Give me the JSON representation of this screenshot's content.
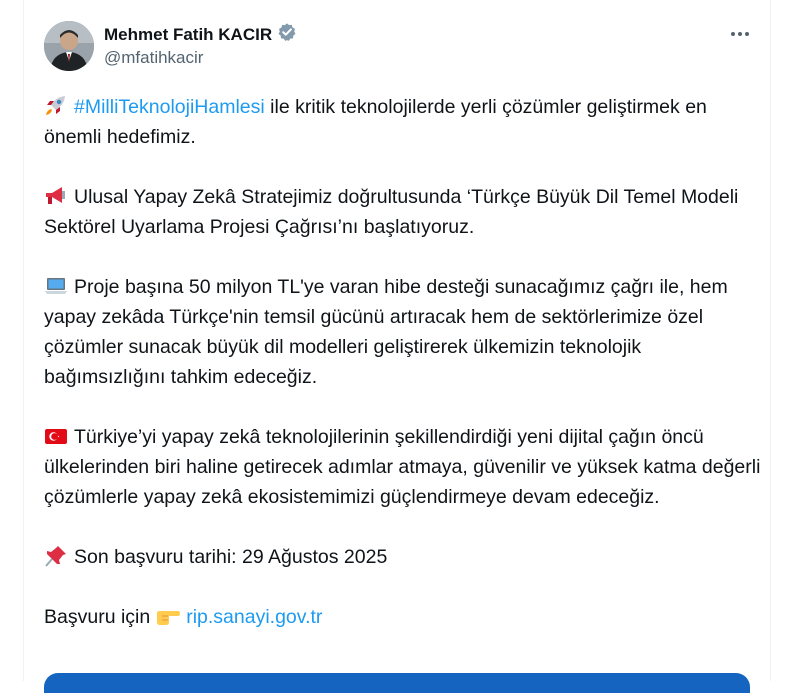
{
  "author": {
    "name": "Mehmet Fatih KACIR",
    "handle": "@mfatihkacir",
    "verified": true
  },
  "icons": {
    "more": "more-horizontal-icon",
    "verified": "verified-badge-icon"
  },
  "tweet": {
    "p1_hashtag": "#MilliTeknolojiHamlesi",
    "p1_text": " ile kritik teknolojilerde yerli çözümler geliştirmek en önemli hedefimiz.",
    "p2_text": "Ulusal Yapay Zekâ Stratejimiz doğrultusunda ‘Türkçe Büyük Dil Temel Modeli Sektörel Uyarlama Projesi Çağrısı’nı başlatıyoruz.",
    "p3_text": "Proje başına 50 milyon TL'ye varan hibe desteği sunacağımız çağrı ile, hem yapay zekâda Türkçe'nin temsil gücünü artıracak hem de sektörlerimize özel çözümler sunacak büyük dil modelleri geliştirerek ülkemizin teknolojik bağımsızlığını tahkim edeceğiz.",
    "p4_text": "Türkiye’yi yapay zekâ teknolojilerinin şekillendirdiği yeni dijital çağın öncü ülkelerinden biri haline getirecek adımlar atmaya, güvenilir ve yüksek katma değerli çözümlerle yapay zekâ ekosistemimizi güçlendirmeye devam edeceğiz.",
    "p5_text": "Son başvuru tarihi: 29 Ağustos 2025",
    "p6_text": "Başvuru için",
    "p6_link": "rip.sanayi.gov.tr"
  },
  "colors": {
    "link": "#1d9bf0",
    "text": "#0f1419",
    "secondary": "#536471",
    "media_preview": "#1565c0"
  }
}
